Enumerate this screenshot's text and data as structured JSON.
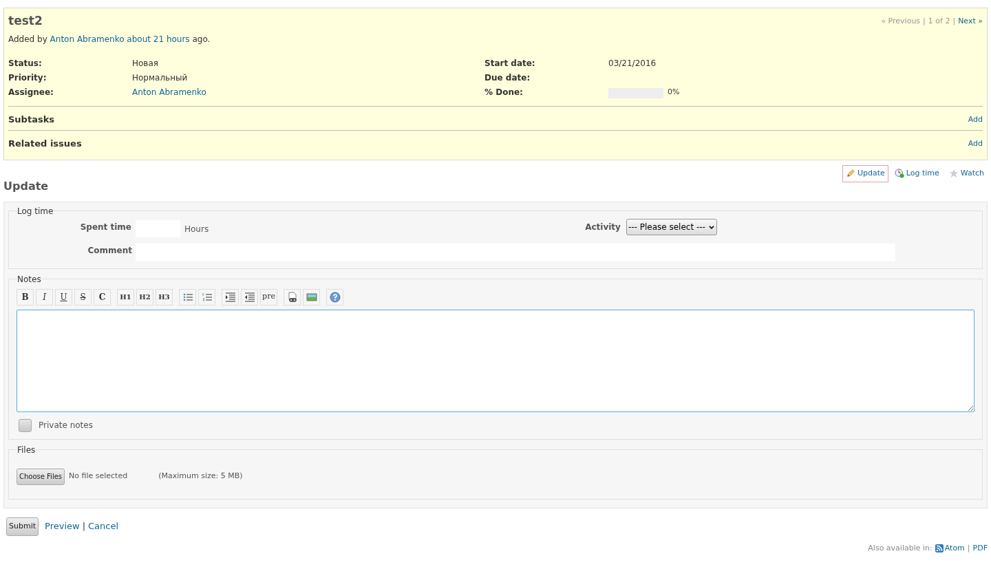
{
  "issue": {
    "title": "test2",
    "added_prefix": "Added by",
    "author": "Anton Abramenko",
    "age": "about 21 hours",
    "added_suffix": "ago."
  },
  "pager": {
    "previous": "« Previous",
    "separator_1": "|",
    "position": "1 of 2",
    "separator_2": "|",
    "next": "Next »"
  },
  "attributes_left": [
    {
      "label": "Status:",
      "value": "Новая",
      "kind": "text"
    },
    {
      "label": "Priority:",
      "value": "Нормальный",
      "kind": "text"
    },
    {
      "label": "Assignee:",
      "value": "Anton Abramenko",
      "kind": "link"
    }
  ],
  "attributes_right": [
    {
      "label": "Start date:",
      "value": "03/21/2016",
      "kind": "text"
    },
    {
      "label": "Due date:",
      "kind": "text"
    },
    {
      "label": "% Done:",
      "kind": "progress",
      "level": 0,
      "reading": "0%"
    }
  ],
  "sections": [
    {
      "title": "Subtasks",
      "action": "Add"
    },
    {
      "title": "Related issues",
      "action": "Add"
    }
  ],
  "actions": [
    {
      "label": "Update",
      "kind": "edit",
      "selected": true
    },
    {
      "label": "Log time",
      "kind": "time",
      "selected": false
    },
    {
      "label": "Watch",
      "kind": "watch",
      "selected": false
    }
  ],
  "heading": "Update",
  "log_time": {
    "legend": "Log time",
    "spent_label": "Spent time",
    "spent_unit": "Hours",
    "activity_label": "Activity",
    "activity_value": "--- Please select ---",
    "comment_label": "Comment"
  },
  "notes": {
    "legend": "Notes",
    "toolbar_groups": [
      {
        "buttons": [
          {
            "kind": "bold",
            "label": "B"
          },
          {
            "kind": "italic",
            "label": "I"
          },
          {
            "kind": "underline",
            "label": "U"
          },
          {
            "kind": "strike",
            "label": "S"
          },
          {
            "kind": "code",
            "label": "C"
          }
        ]
      },
      {
        "buttons": [
          {
            "kind": "heading",
            "label": "H1"
          },
          {
            "kind": "heading",
            "label": "H2"
          },
          {
            "kind": "heading",
            "label": "H3"
          }
        ]
      },
      {
        "buttons": [
          {
            "kind": "ul"
          },
          {
            "kind": "ol"
          }
        ]
      },
      {
        "buttons": [
          {
            "kind": "indent"
          },
          {
            "kind": "outdent"
          },
          {
            "kind": "pre",
            "label": "pre"
          }
        ]
      },
      {
        "buttons": [
          {
            "kind": "link"
          },
          {
            "kind": "image"
          }
        ]
      },
      {
        "buttons": [
          {
            "kind": "help"
          }
        ]
      }
    ],
    "private_label": "Private notes",
    "private_checked": false
  },
  "files": {
    "legend": "Files",
    "button": "Choose Files",
    "status": "No file selected",
    "max_size": "(Maximum size: 5 MB)"
  },
  "form_buttons": {
    "submit": "Submit",
    "preview": "Preview",
    "separator": "|",
    "cancel": "Cancel"
  },
  "footer": {
    "prefix": "Also available in:",
    "formats": [
      "Atom",
      "PDF"
    ],
    "separator": "|"
  }
}
